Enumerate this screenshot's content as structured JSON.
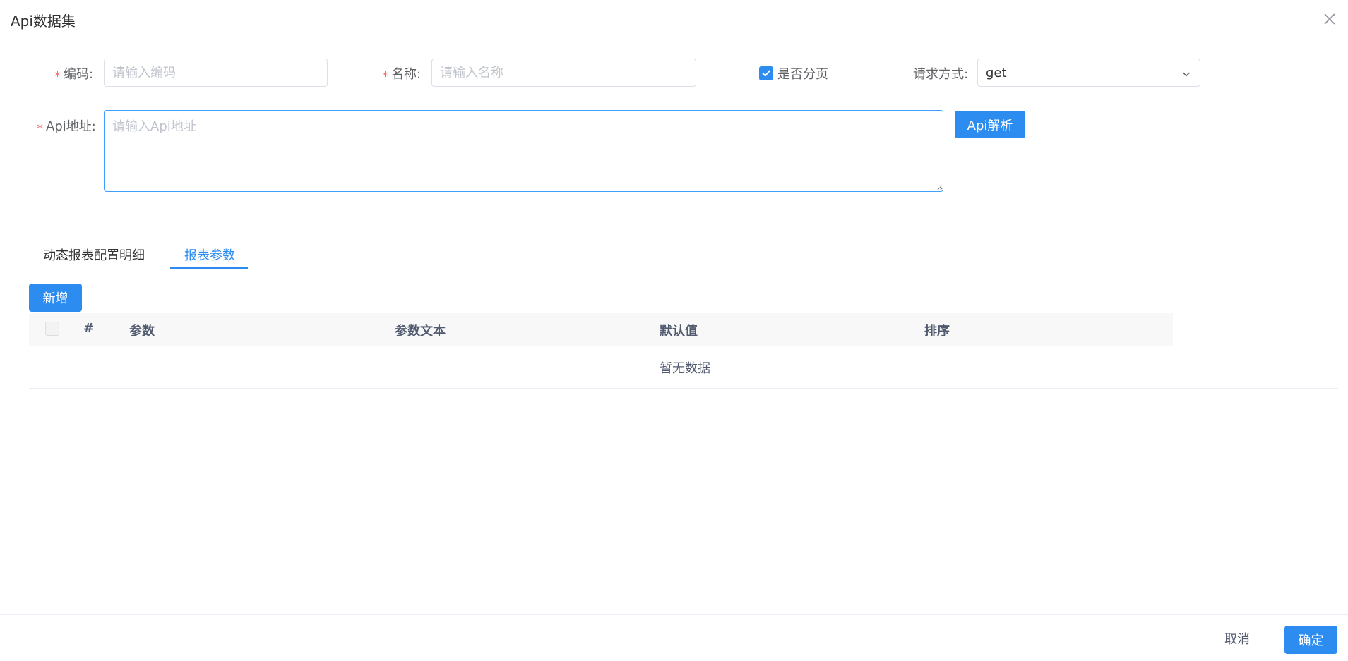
{
  "dialog": {
    "title": "Api数据集"
  },
  "form": {
    "code": {
      "label": "编码:",
      "placeholder": "请输入编码",
      "value": ""
    },
    "name": {
      "label": "名称:",
      "placeholder": "请输入名称",
      "value": ""
    },
    "paging": {
      "label": "是否分页",
      "checked": true
    },
    "method": {
      "label": "请求方式:",
      "value": "get"
    },
    "api_url": {
      "label": "Api地址:",
      "placeholder": "请输入Api地址",
      "value": ""
    },
    "parse_button": "Api解析",
    "required_mark": "*"
  },
  "tabs": [
    {
      "label": "动态报表配置明细",
      "active": false
    },
    {
      "label": "报表参数",
      "active": true
    }
  ],
  "toolbar": {
    "add_label": "新增"
  },
  "table": {
    "columns": [
      "#",
      "参数",
      "参数文本",
      "默认值",
      "排序"
    ],
    "rows": [],
    "empty_text": "暂无数据"
  },
  "footer": {
    "cancel_label": "取消",
    "confirm_label": "确定"
  },
  "colors": {
    "primary": "#2d8cf0",
    "required": "#f56c6c",
    "border": "#dcdfe6",
    "header_bg": "#f8f8f9"
  }
}
